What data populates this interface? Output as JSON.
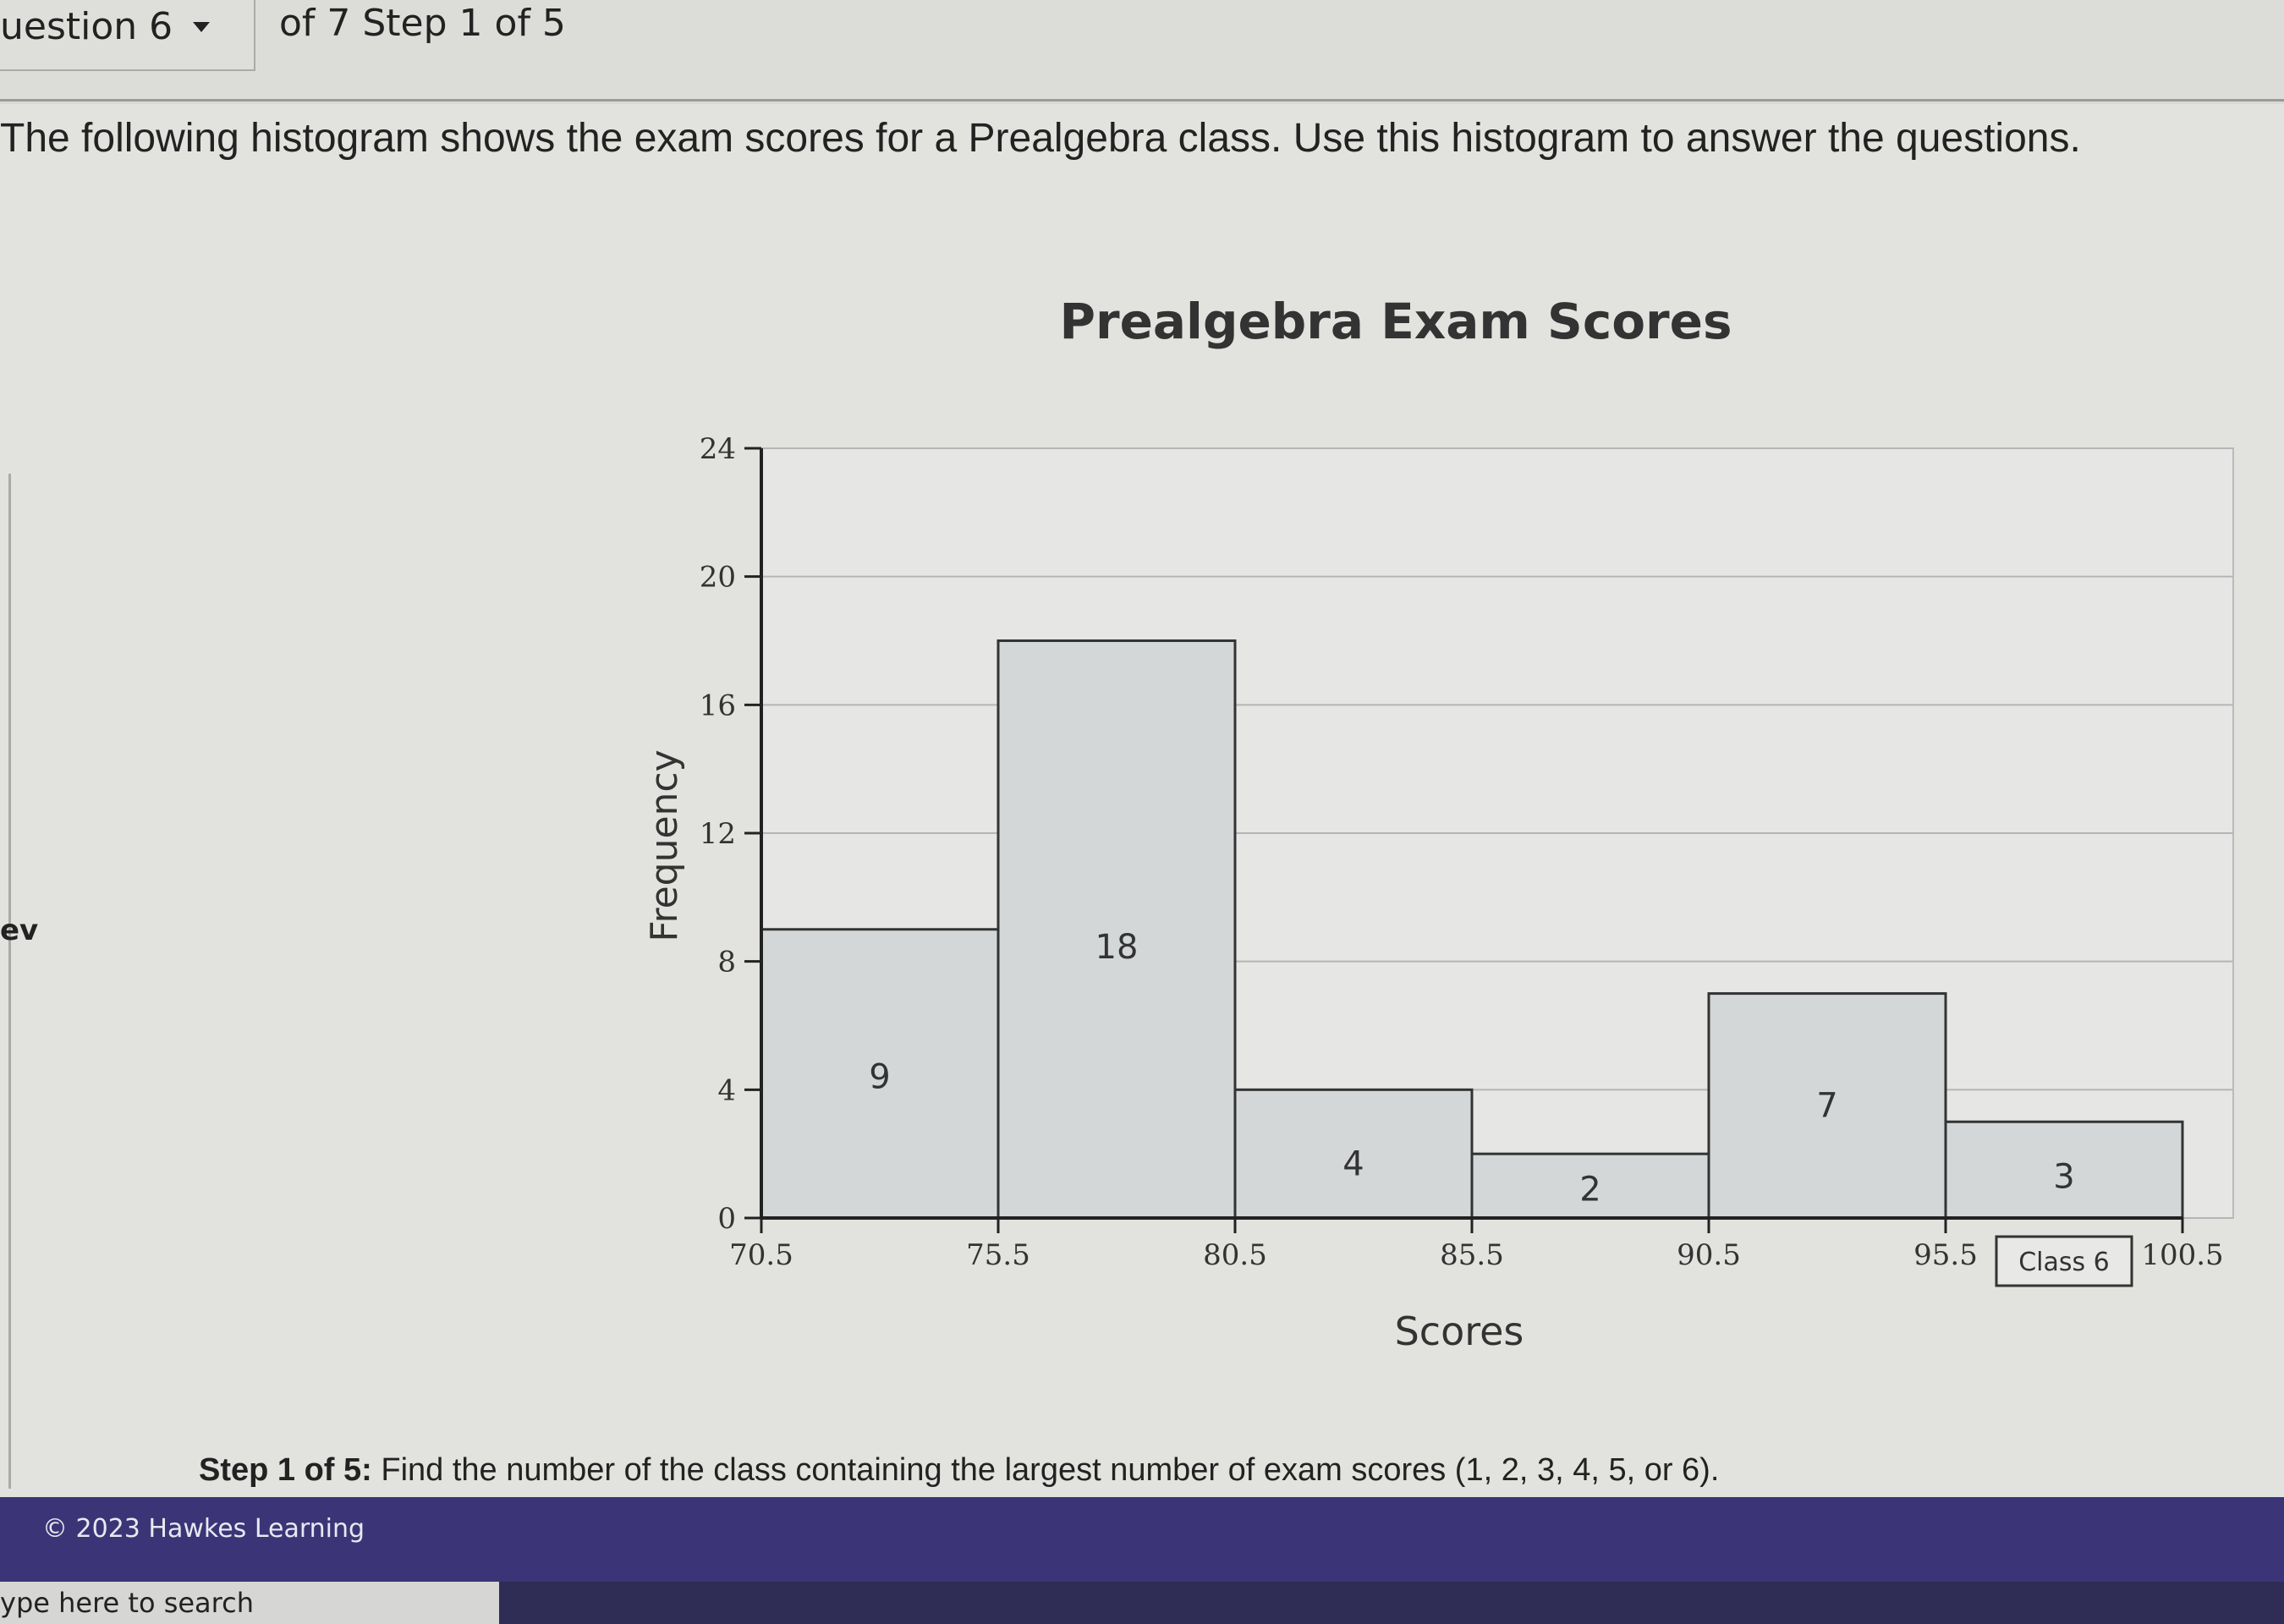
{
  "header": {
    "question_selector": "uestion 6",
    "step_info": "of 7 Step 1 of 5"
  },
  "prompt": "The following histogram shows the exam scores for a Prealgebra class. Use this histogram to answer the questions.",
  "side_label": "ev",
  "chart_data": {
    "type": "bar",
    "title": "Prealgebra Exam Scores",
    "xlabel": "Scores",
    "ylabel": "Frequency",
    "bin_edges": [
      70.5,
      75.5,
      80.5,
      85.5,
      90.5,
      95.5,
      100.5
    ],
    "bin_edge_labels": [
      "70.5",
      "75.5",
      "80.5",
      "85.5",
      "90.5",
      "95.5",
      "100.5"
    ],
    "values": [
      9,
      18,
      4,
      2,
      7,
      3
    ],
    "data_labels": [
      "9",
      "18",
      "4",
      "2",
      "7",
      "3"
    ],
    "ylim": [
      0,
      24
    ],
    "yticks": [
      0,
      4,
      8,
      12,
      16,
      20,
      24
    ],
    "ytick_labels": [
      "0",
      "4",
      "8",
      "12",
      "16",
      "20",
      "24"
    ],
    "grid": true,
    "bar_color": "#d3d7d8",
    "annotation": "Class 6"
  },
  "step": {
    "bold": "Step 1 of 5:",
    "text": " Find the number of the class containing the largest number of exam scores (1, 2, 3, 4, 5, or 6)."
  },
  "footer": {
    "copyright": "© 2023 Hawkes Learning",
    "color": "#3b3577"
  },
  "taskbar": {
    "search_placeholder": "ype here to search"
  }
}
